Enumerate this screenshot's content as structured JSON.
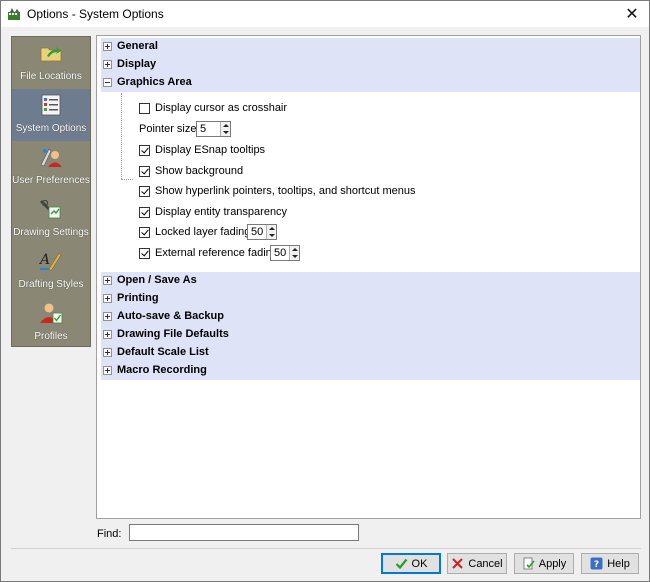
{
  "window": {
    "title": "Options - System Options",
    "close_glyph": "✕"
  },
  "sidebar": {
    "items": [
      {
        "label": "File Locations",
        "icon": "folder-arrow-icon"
      },
      {
        "label": "System Options",
        "icon": "system-list-icon"
      },
      {
        "label": "User Preferences",
        "icon": "user-preferences-icon"
      },
      {
        "label": "Drawing Settings",
        "icon": "drawing-tools-icon"
      },
      {
        "label": "Drafting Styles",
        "icon": "drafting-styles-icon"
      },
      {
        "label": "Profiles",
        "icon": "profile-user-icon"
      }
    ],
    "active_index": 1
  },
  "sections_top": [
    {
      "label": "General",
      "expanded": false
    },
    {
      "label": "Display",
      "expanded": false
    },
    {
      "label": "Graphics Area",
      "expanded": true
    }
  ],
  "graphics_area": {
    "crosshair_label": "Display cursor as crosshair",
    "crosshair_checked": false,
    "pointer_size_label": "Pointer size:",
    "pointer_size_value": "5",
    "esnap_label": "Display ESnap tooltips",
    "esnap_checked": true,
    "background_label": "Show background",
    "background_checked": true,
    "hyperlink_label": "Show hyperlink pointers, tooltips, and shortcut menus",
    "hyperlink_checked": true,
    "transparency_label": "Display entity transparency",
    "transparency_checked": true,
    "locked_fading_label": "Locked layer fading",
    "locked_fading_checked": true,
    "locked_fading_value": "50",
    "xref_fading_label": "External reference fading",
    "xref_fading_checked": true,
    "xref_fading_value": "50"
  },
  "sections_bottom": [
    {
      "label": "Open / Save As",
      "expanded": false
    },
    {
      "label": "Printing",
      "expanded": false
    },
    {
      "label": "Auto-save & Backup",
      "expanded": false
    },
    {
      "label": "Drawing File Defaults",
      "expanded": false
    },
    {
      "label": "Default Scale List",
      "expanded": false
    },
    {
      "label": "Macro Recording",
      "expanded": false
    }
  ],
  "find": {
    "label": "Find:",
    "value": ""
  },
  "buttons": {
    "ok": "OK",
    "cancel": "Cancel",
    "apply": "Apply",
    "help": "Help"
  },
  "colors": {
    "section_bg": "#dfe3f7",
    "sidebar_bg": "#8a8874",
    "sidebar_active": "#6e7c8f",
    "default_button_border": "#0078d7"
  }
}
